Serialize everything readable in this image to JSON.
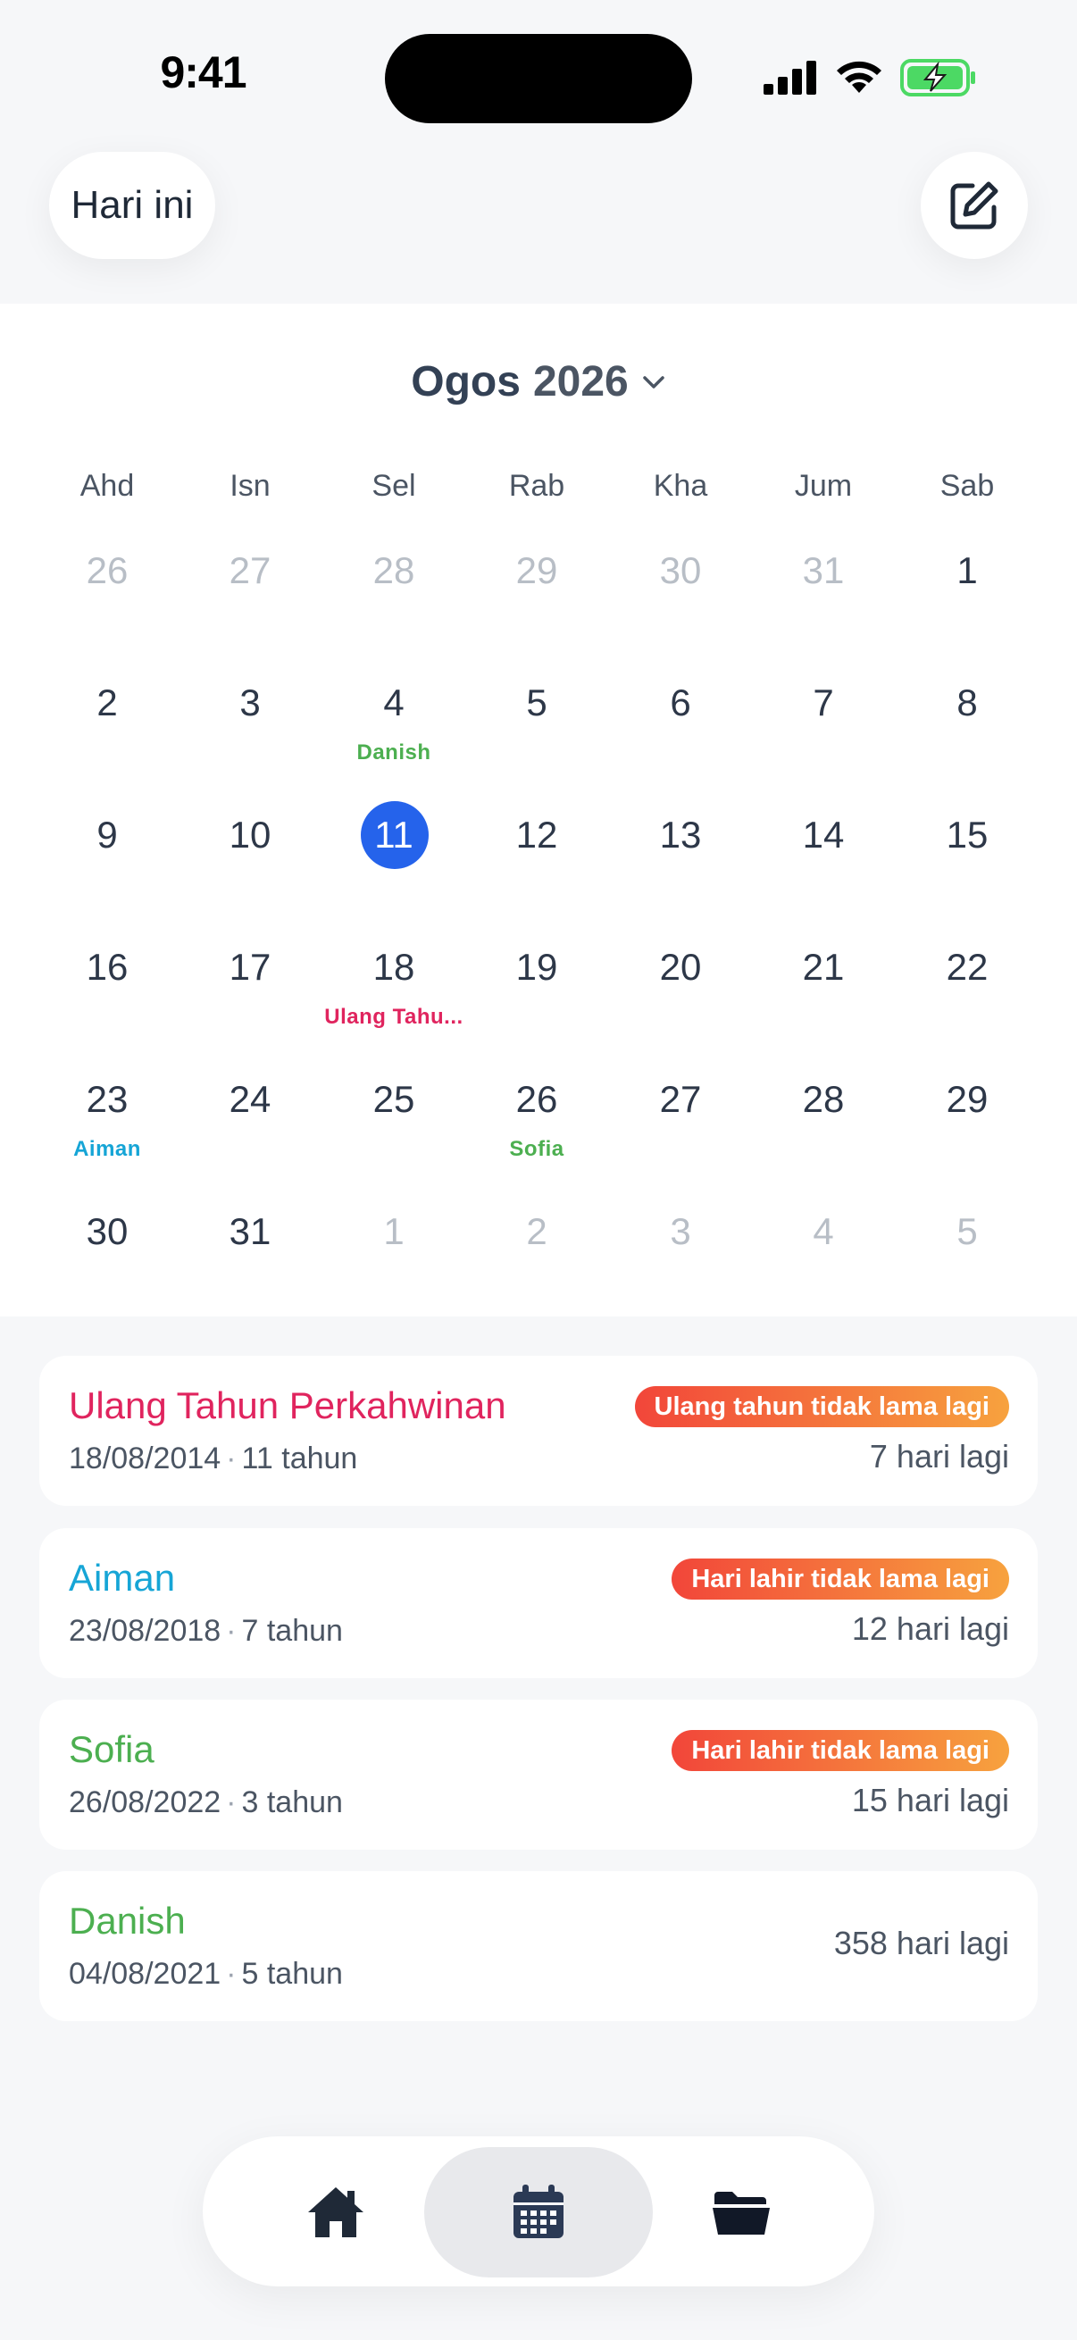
{
  "status": {
    "time": "9:41"
  },
  "header": {
    "today_label": "Hari ini"
  },
  "calendar": {
    "month": "Ogos",
    "year": "2026",
    "weekdays": [
      "Ahd",
      "Isn",
      "Sel",
      "Rab",
      "Kha",
      "Jum",
      "Sab"
    ],
    "weeks": [
      [
        {
          "d": "26",
          "o": true
        },
        {
          "d": "27",
          "o": true
        },
        {
          "d": "28",
          "o": true
        },
        {
          "d": "29",
          "o": true
        },
        {
          "d": "30",
          "o": true
        },
        {
          "d": "31",
          "o": true
        },
        {
          "d": "1"
        }
      ],
      [
        {
          "d": "2"
        },
        {
          "d": "3"
        },
        {
          "d": "4",
          "evt": "Danish",
          "c": "#4caf50"
        },
        {
          "d": "5"
        },
        {
          "d": "6"
        },
        {
          "d": "7"
        },
        {
          "d": "8"
        }
      ],
      [
        {
          "d": "9"
        },
        {
          "d": "10"
        },
        {
          "d": "11",
          "today": true
        },
        {
          "d": "12"
        },
        {
          "d": "13"
        },
        {
          "d": "14"
        },
        {
          "d": "15"
        }
      ],
      [
        {
          "d": "16"
        },
        {
          "d": "17"
        },
        {
          "d": "18",
          "evt": "Ulang Tahu...",
          "c": "#e0245e"
        },
        {
          "d": "19"
        },
        {
          "d": "20"
        },
        {
          "d": "21"
        },
        {
          "d": "22"
        }
      ],
      [
        {
          "d": "23",
          "evt": "Aiman",
          "c": "#16a5d6"
        },
        {
          "d": "24"
        },
        {
          "d": "25"
        },
        {
          "d": "26",
          "evt": "Sofia",
          "c": "#4caf50"
        },
        {
          "d": "27"
        },
        {
          "d": "28"
        },
        {
          "d": "29"
        }
      ],
      [
        {
          "d": "30"
        },
        {
          "d": "31"
        },
        {
          "d": "1",
          "o": true
        },
        {
          "d": "2",
          "o": true
        },
        {
          "d": "3",
          "o": true
        },
        {
          "d": "4",
          "o": true
        },
        {
          "d": "5",
          "o": true
        }
      ]
    ]
  },
  "events": [
    {
      "name": "Ulang Tahun Perkahwinan",
      "color": "#e0245e",
      "date": "18/08/2014",
      "age": "11 tahun",
      "badge": "Ulang tahun tidak lama lagi",
      "days": "7 hari lagi"
    },
    {
      "name": "Aiman",
      "color": "#16a5d6",
      "date": "23/08/2018",
      "age": "7 tahun",
      "badge": "Hari lahir tidak lama lagi",
      "days": "12 hari lagi"
    },
    {
      "name": "Sofia",
      "color": "#4caf50",
      "date": "26/08/2022",
      "age": "3 tahun",
      "badge": "Hari lahir tidak lama lagi",
      "days": "15 hari lagi"
    },
    {
      "name": "Danish",
      "color": "#4caf50",
      "date": "04/08/2021",
      "age": "5 tahun",
      "badge": "",
      "days": "358 hari lagi"
    }
  ],
  "nav": {
    "items": [
      {
        "icon": "home-icon",
        "active": false
      },
      {
        "icon": "calendar-icon",
        "active": true
      },
      {
        "icon": "folder-icon",
        "active": false
      }
    ]
  }
}
